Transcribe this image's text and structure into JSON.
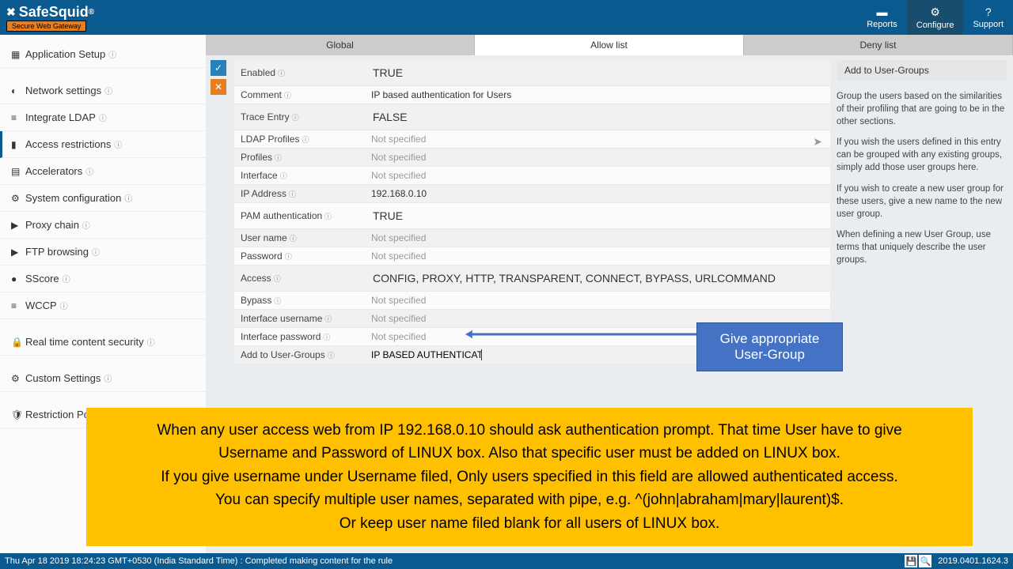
{
  "header": {
    "logo_text": "SafeSquid",
    "logo_sub": "Secure Web Gateway",
    "nav": [
      {
        "icon": "▬",
        "label": "Reports"
      },
      {
        "icon": "⚙",
        "label": "Configure"
      },
      {
        "icon": "?",
        "label": "Support"
      }
    ]
  },
  "sidebar": {
    "items": [
      {
        "icon": "▦",
        "label": "Application Setup"
      },
      {
        "icon": "◐",
        "label": "Network settings"
      },
      {
        "icon": "≡",
        "label": "Integrate LDAP"
      },
      {
        "icon": "▮",
        "label": "Access restrictions"
      },
      {
        "icon": "▤",
        "label": "Accelerators"
      },
      {
        "icon": "⚙",
        "label": "System configuration"
      },
      {
        "icon": "▶",
        "label": "Proxy chain"
      },
      {
        "icon": "▶",
        "label": "FTP browsing"
      },
      {
        "icon": "●",
        "label": "SScore"
      },
      {
        "icon": "≡",
        "label": "WCCP"
      },
      {
        "icon": "🔒",
        "label": "Real time content security"
      },
      {
        "icon": "⚙",
        "label": "Custom Settings"
      },
      {
        "icon": "🛡",
        "label": "Restriction Policies"
      }
    ]
  },
  "tabs": [
    "Global",
    "Allow list",
    "Deny list"
  ],
  "form": {
    "rows": [
      {
        "label": "Enabled",
        "value": "TRUE",
        "big": true
      },
      {
        "label": "Comment",
        "value": "IP based authentication for Users"
      },
      {
        "label": "Trace Entry",
        "value": "FALSE",
        "big": true
      },
      {
        "label": "LDAP Profiles",
        "value": "Not specified",
        "placeholder": true,
        "send": true
      },
      {
        "label": "Profiles",
        "value": "Not specified",
        "placeholder": true
      },
      {
        "label": "Interface",
        "value": "Not specified",
        "placeholder": true
      },
      {
        "label": "IP Address",
        "value": "192.168.0.10"
      },
      {
        "label": "PAM authentication",
        "value": "TRUE",
        "big": true
      },
      {
        "label": "User name",
        "value": "Not specified",
        "placeholder": true
      },
      {
        "label": "Password",
        "value": "Not specified",
        "placeholder": true
      },
      {
        "label": "Access",
        "value": "CONFIG,   PROXY,   HTTP,   TRANSPARENT,   CONNECT,   BYPASS,   URLCOMMAND",
        "big": true
      },
      {
        "label": "Bypass",
        "value": "Not specified",
        "placeholder": true
      },
      {
        "label": "Interface username",
        "value": "Not specified",
        "placeholder": true
      },
      {
        "label": "Interface password",
        "value": "Not specified",
        "placeholder": true
      },
      {
        "label": "Add to User-Groups",
        "value": "IP BASED AUTHENTICATION",
        "input": true
      }
    ]
  },
  "right": {
    "button": "Add to User-Groups",
    "paras": [
      "Group the users based on the similarities of their profiling that are going to be in the other sections.",
      "If you wish the users defined in this entry can be grouped with any existing groups, simply add those user groups here.",
      "If you wish to create a new user group for these users, give a new name to the new user group.",
      "When defining a new User Group, use terms that uniquely describe the user groups."
    ]
  },
  "callout": {
    "line1": "Give appropriate",
    "line2": "User-Group"
  },
  "yellow": {
    "l1": "When any user access web from IP 192.168.0.10 should ask authentication prompt. That time User have to give",
    "l2": "Username and Password of LINUX box. Also that specific user must be added on LINUX box.",
    "l3": "If you give username under Username filed, Only users specified in this field are allowed authenticated access.",
    "l4": "You can specify multiple user names, separated with pipe, e.g. ^(john|abraham|mary|laurent)$.",
    "l5": "Or keep user name filed blank for all users of LINUX box."
  },
  "footer": {
    "left": "Thu Apr 18 2019 18:24:23 GMT+0530 (India Standard Time) : Completed making content for the rule",
    "version": "2019.0401.1624.3"
  }
}
